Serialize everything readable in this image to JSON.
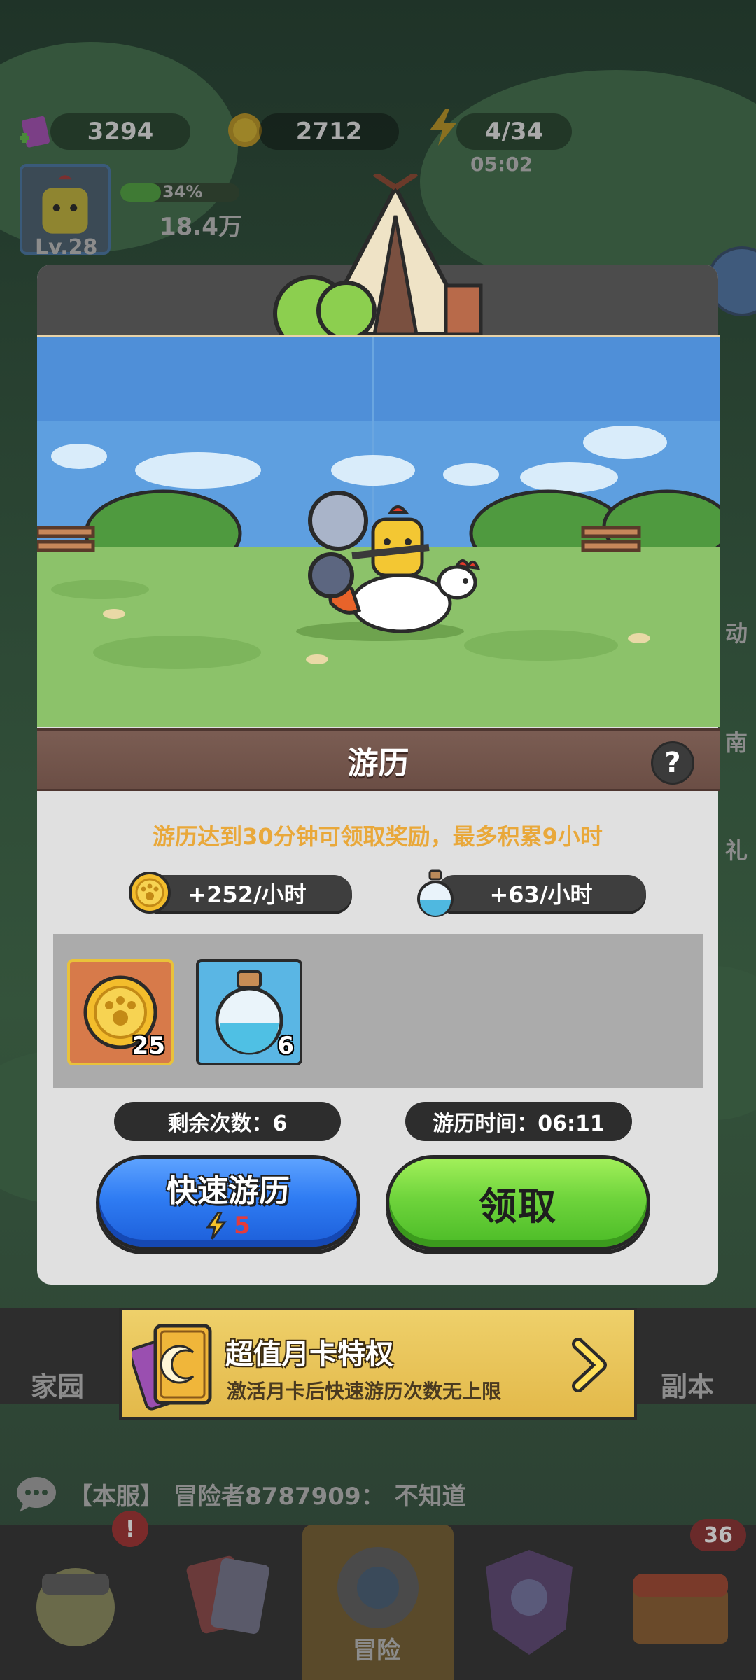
{
  "background": {
    "resources": [
      {
        "name": "gem",
        "value": "3294"
      },
      {
        "name": "coin",
        "value": "2712"
      },
      {
        "name": "energy",
        "value": "4/34"
      }
    ],
    "energy_timer": "05:02",
    "player": {
      "level": "Lv.28",
      "exp_percent": "34%",
      "power": "18.4万"
    },
    "left_nav_labels": [
      "家园"
    ],
    "right_nav_labels": [
      "副本"
    ],
    "side_labels": [
      "动",
      "南",
      "礼"
    ],
    "chat": {
      "prefix": "【本服】",
      "speaker": "冒险者8787909：",
      "message": "不知道"
    },
    "bottom_nav": {
      "active_label": "冒险",
      "badge_count": "36",
      "alert_mark": "!"
    }
  },
  "popup": {
    "title": "游历",
    "help_label": "?",
    "hint": "游历达到30分钟可领取奖励，最多积累9小时",
    "rates": [
      {
        "icon": "coin-icon",
        "label": "+252/小时"
      },
      {
        "icon": "potion-icon",
        "label": "+63/小时"
      }
    ],
    "rewards": [
      {
        "icon": "coin-icon",
        "count": "25"
      },
      {
        "icon": "potion-icon",
        "count": "6"
      }
    ],
    "remaining_label": "剩余次数：6",
    "time_label": "游历时间：06:11",
    "quick_button": {
      "label": "快速游历",
      "cost": "5",
      "cost_icon": "energy-icon"
    },
    "claim_button": {
      "label": "领取"
    }
  },
  "card_banner": {
    "title": "超值月卡特权",
    "subtitle": "激活月卡后快速游历次数无上限"
  },
  "colors": {
    "hint": "#e9a83a",
    "quick_button": "#2f7cf3",
    "claim_button": "#6fd43c",
    "title_bar": "#6b4e45",
    "banner": "#e3b94a"
  }
}
